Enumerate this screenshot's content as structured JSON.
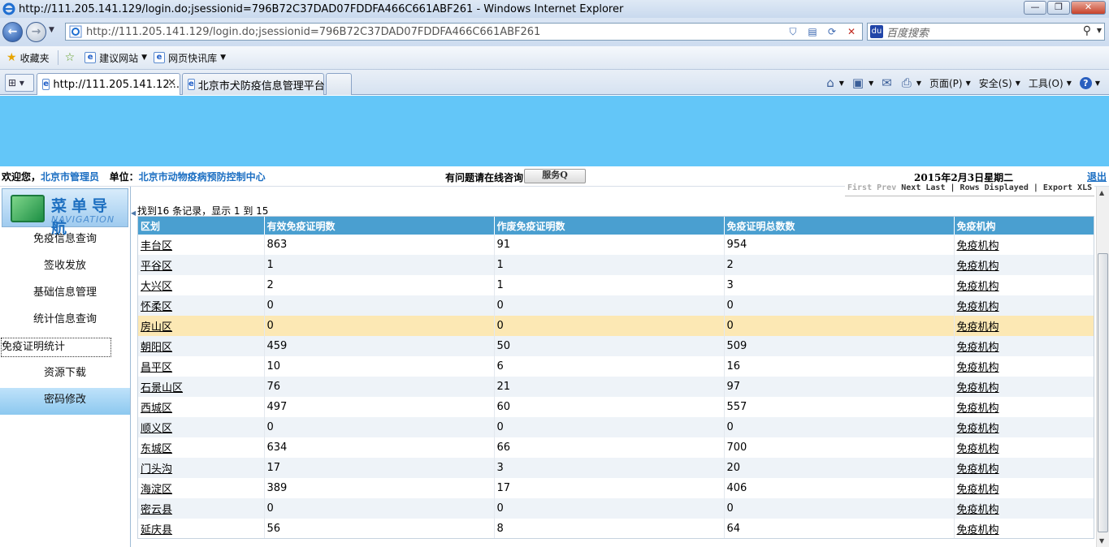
{
  "window": {
    "title": "http://111.205.141.129/login.do;jsessionid=796B72C37DAD07FDDFA466C661ABF261 - Windows Internet Explorer",
    "min": "—",
    "max": "❐",
    "close": "✕"
  },
  "address": {
    "url": "http://111.205.141.129/login.do;jsessionid=796B72C37DAD07FDDFA466C661ABF261",
    "search_placeholder": "百度搜索"
  },
  "favorites": {
    "label": "收藏夹",
    "items": [
      "建议网站",
      "网页快讯库"
    ]
  },
  "tabs": [
    {
      "label": "http://111.205.141.12..."
    },
    {
      "label": "北京市犬防疫信息管理平台"
    }
  ],
  "commands": {
    "page": "页面(P)",
    "safety": "安全(S)",
    "tools": "工具(O)"
  },
  "infobar": {
    "welcome_label": "欢迎您，",
    "user": "北京市管理员",
    "unit_label": "单位：",
    "unit": "北京市动物疫病预防控制中心",
    "help_text": "有问题请在线咨询",
    "consult_button": "服务Q",
    "date": "2015年2月3日星期二",
    "logout": "退出"
  },
  "sidebar": {
    "title_cn": "菜单导航",
    "title_en": "NAVIGATION",
    "items": [
      {
        "label": "免疫信息查询"
      },
      {
        "label": "签收发放"
      },
      {
        "label": "基础信息管理"
      },
      {
        "label": "统计信息查询"
      },
      {
        "label": "免疫证明统计"
      },
      {
        "label": "资源下载"
      },
      {
        "label": "密码修改"
      }
    ]
  },
  "pager": {
    "first": "First",
    "prev": "Prev",
    "next": "Next",
    "last": "Last",
    "rows": "Rows Displayed",
    "export": "Export XLS"
  },
  "grid": {
    "records_text": "找到16 条记录，显示  1 到  15",
    "columns": [
      "区划",
      "有效免疫证明数",
      "作废免疫证明数",
      "免疫证明总数数",
      "免疫机构"
    ],
    "rows": [
      [
        "丰台区",
        "863",
        "91",
        "954",
        "免疫机构"
      ],
      [
        "平谷区",
        "1",
        "1",
        "2",
        "免疫机构"
      ],
      [
        "大兴区",
        "2",
        "1",
        "3",
        "免疫机构"
      ],
      [
        "怀柔区",
        "0",
        "0",
        "0",
        "免疫机构"
      ],
      [
        "房山区",
        "0",
        "0",
        "0",
        "免疫机构"
      ],
      [
        "朝阳区",
        "459",
        "50",
        "509",
        "免疫机构"
      ],
      [
        "昌平区",
        "10",
        "6",
        "16",
        "免疫机构"
      ],
      [
        "石景山区",
        "76",
        "21",
        "97",
        "免疫机构"
      ],
      [
        "西城区",
        "497",
        "60",
        "557",
        "免疫机构"
      ],
      [
        "顺义区",
        "0",
        "0",
        "0",
        "免疫机构"
      ],
      [
        "东城区",
        "634",
        "66",
        "700",
        "免疫机构"
      ],
      [
        "门头沟",
        "17",
        "3",
        "20",
        "免疫机构"
      ],
      [
        "海淀区",
        "389",
        "17",
        "406",
        "免疫机构"
      ],
      [
        "密云县",
        "0",
        "0",
        "0",
        "免疫机构"
      ],
      [
        "延庆县",
        "56",
        "8",
        "64",
        "免疫机构"
      ]
    ]
  }
}
